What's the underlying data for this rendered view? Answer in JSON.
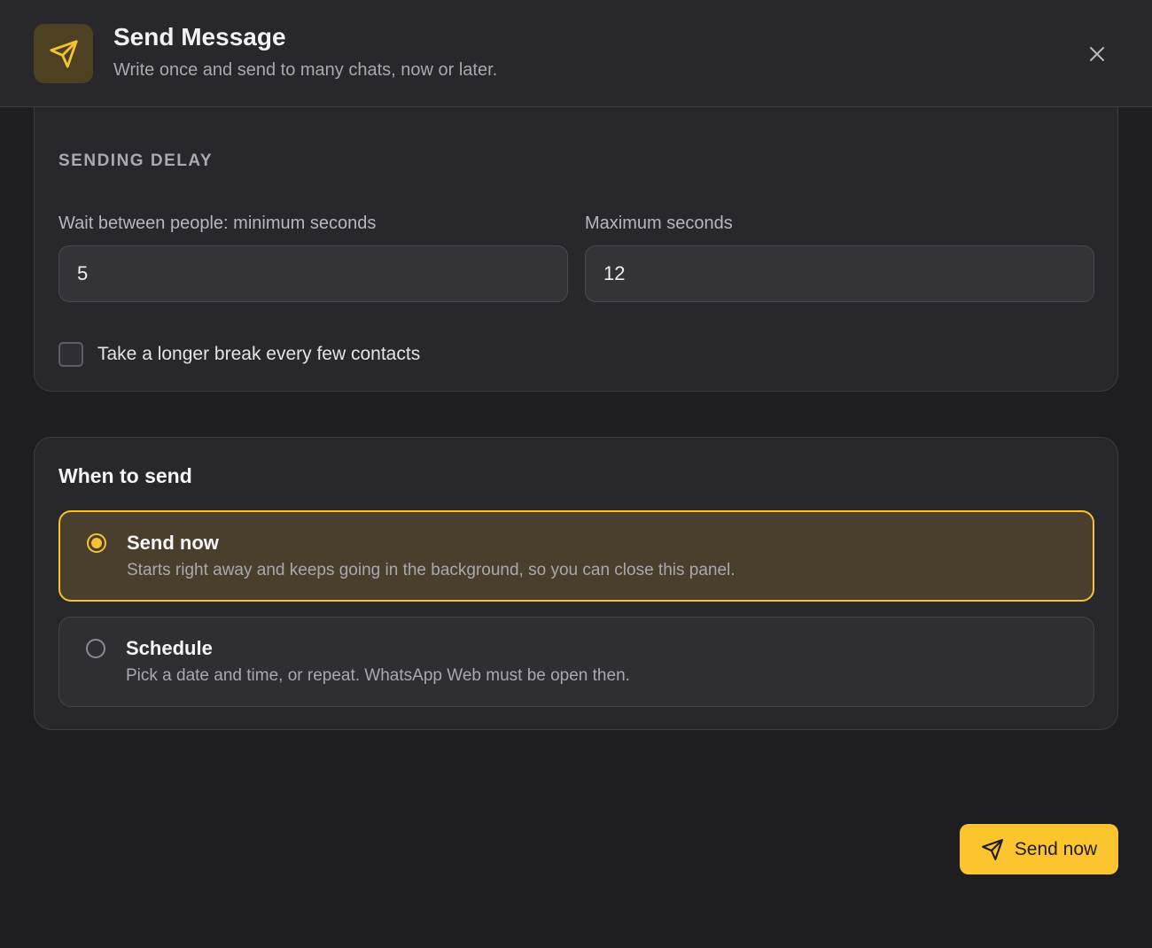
{
  "header": {
    "icon": "paper-plane-icon",
    "title": "Send Message",
    "subtitle": "Write once and send to many chats, now or later.",
    "close_icon": "close-icon"
  },
  "delay": {
    "section_label": "SENDING DELAY",
    "min_label": "Wait between people: minimum seconds",
    "min_value": "5",
    "max_label": "Maximum seconds",
    "max_value": "12",
    "break_label": "Take a longer break every few contacts",
    "break_checked": false
  },
  "when": {
    "title": "When to send",
    "options": [
      {
        "title": "Send now",
        "desc": "Starts right away and keeps going in the background, so you can close this panel.",
        "selected": true
      },
      {
        "title": "Schedule",
        "desc": "Pick a date and time, or repeat. WhatsApp Web must be open then.",
        "selected": false
      }
    ]
  },
  "footer": {
    "send_label": "Send now",
    "send_icon": "paper-plane-icon"
  },
  "colors": {
    "accent": "#fcc42d",
    "background": "#1e1e21",
    "card": "#28282c"
  }
}
